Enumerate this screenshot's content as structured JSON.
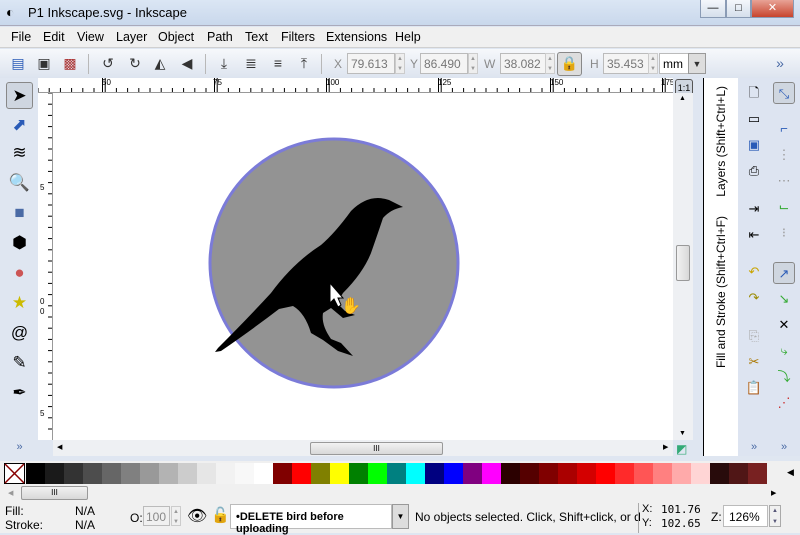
{
  "window": {
    "title": "P1 Inkscape.svg - Inkscape",
    "min": "—",
    "max": "□",
    "close": "✕"
  },
  "menu": [
    "File",
    "Edit",
    "View",
    "Layer",
    "Object",
    "Path",
    "Text",
    "Filters",
    "Extensions",
    "Help"
  ],
  "toolbar": {
    "x_label": "X",
    "x": "79.613",
    "y_label": "Y",
    "y": "86.490",
    "w_label": "W",
    "w": "38.082",
    "h_label": "H",
    "h": "35.453",
    "unit": "mm",
    "more": "»"
  },
  "ruler": {
    "top": [
      "50",
      "75",
      "100",
      "125",
      "150",
      "175"
    ],
    "left": [
      "5",
      "0",
      "0",
      "5"
    ]
  },
  "dock": {
    "layers": "Layers (Shift+Ctrl+L)",
    "fill_stroke": "Fill and Stroke (Shift+Ctrl+F)"
  },
  "palette": [
    "#000000",
    "#1a1a1a",
    "#333333",
    "#4d4d4d",
    "#666666",
    "#808080",
    "#999999",
    "#b3b3b3",
    "#cccccc",
    "#e6e6e6",
    "#f2f2f2",
    "#f8f8f8",
    "#ffffff",
    "#800000",
    "#ff0000",
    "#808000",
    "#ffff00",
    "#008000",
    "#00ff00",
    "#008080",
    "#00ffff",
    "#000080",
    "#0000ff",
    "#800080",
    "#ff00ff",
    "#2b0000",
    "#550000",
    "#800000",
    "#aa0000",
    "#d40000",
    "#ff0000",
    "#ff2a2a",
    "#ff5555",
    "#ff8080",
    "#ffaaaa",
    "#ffd5d5",
    "#280b0b",
    "#501616",
    "#782121"
  ],
  "status": {
    "fill_label": "Fill:",
    "fill": "N/A",
    "stroke_label": "Stroke:",
    "stroke": "N/A",
    "opacity_label": "O:",
    "opacity": "100",
    "layer": "•DELETE bird before uploading",
    "message": "No objects selected. Click, Shift+click, or d",
    "x_label": "X:",
    "x": "101.76",
    "y_label": "Y:",
    "y": "102.65",
    "zoom_label": "Z:",
    "zoom": "126%"
  },
  "colors": {
    "circle_fill": "#939393",
    "circle_stroke": "#7b7bd8",
    "bird": "#000000"
  }
}
